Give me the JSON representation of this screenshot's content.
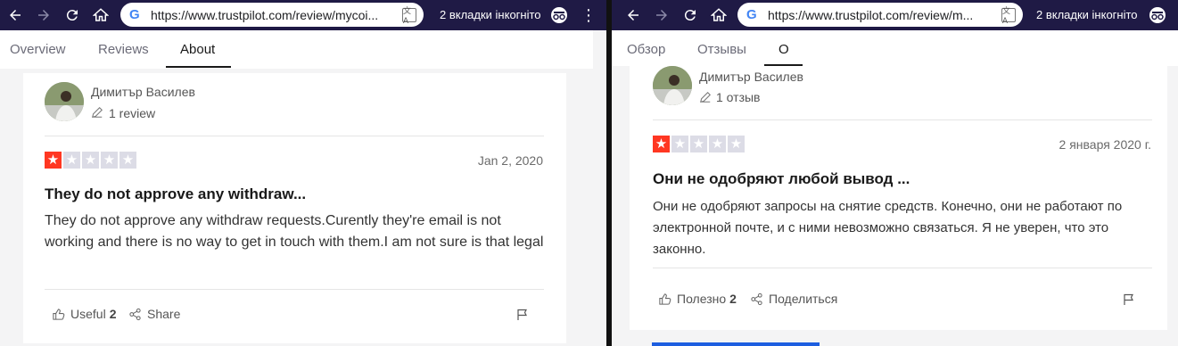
{
  "left": {
    "url": "https://www.trustpilot.com/review/mycoi...",
    "incognito_text": "2 вкладки інкогніто",
    "tabs": [
      "Overview",
      "Reviews",
      "About"
    ],
    "active_tab": "About",
    "reviewer_name": "Димитър Василев",
    "review_count": "1 review",
    "stars": 1,
    "date": "Jan 2, 2020",
    "title": "They do not approve any withdraw...",
    "body": "They do not approve any withdraw requests.Curently they're email is not working and there is no way to get in touch with them.I am not sure is that legal",
    "useful_label": "Useful",
    "useful_count": "2",
    "share_label": "Share"
  },
  "right": {
    "url": "https://www.trustpilot.com/review/m...",
    "incognito_text": "2 вкладки інкогніто",
    "tabs": [
      "Обзор",
      "Отзывы",
      "О"
    ],
    "active_tab": "О",
    "reviewer_name": "Димитър Василев",
    "review_count": "1 отзыв",
    "stars": 1,
    "date": "2 января 2020 г.",
    "title": "Они не одобряют любой вывод ...",
    "body": "Они не одобряют запросы на снятие средств. Конечно, они не работают по электронной почте, и с ними невозможно связаться. Я не уверен, что это законно.",
    "useful_label": "Полезно",
    "useful_count": "2",
    "share_label": "Поделиться"
  },
  "colors": {
    "toolbar": "#1f1a45",
    "star_red": "#ff3722",
    "star_grey": "#dcdce6",
    "accent_blue": "#1d5ee0"
  },
  "icons": [
    "back-arrow-icon",
    "forward-arrow-icon",
    "reload-icon",
    "home-icon",
    "google-g-icon",
    "translate-icon",
    "incognito-icon",
    "more-vert-icon",
    "pencil-icon",
    "star-icon",
    "thumbs-up-icon",
    "share-icon",
    "flag-icon"
  ]
}
